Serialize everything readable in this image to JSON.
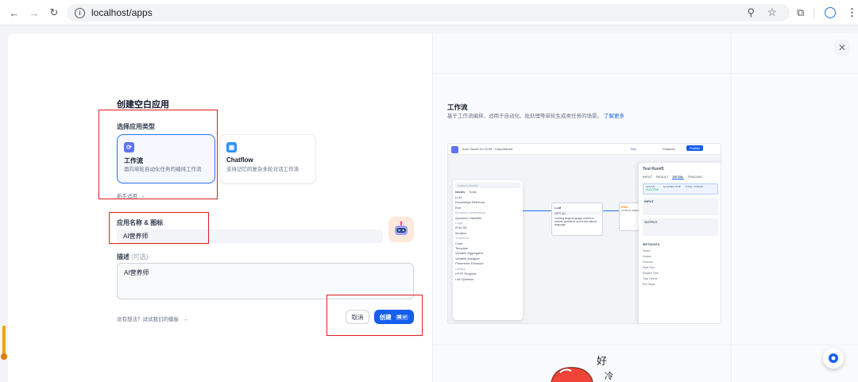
{
  "browser": {
    "url": "localhost/apps",
    "icons": [
      "back-icon",
      "forward-icon",
      "reload-icon",
      "info-icon",
      "zoom-icon",
      "star-icon",
      "extensions-icon",
      "profile-icon",
      "menu-icon"
    ]
  },
  "dialog": {
    "title": "创建空白应用",
    "app_type": {
      "label": "选择应用类型",
      "cards": [
        {
          "title": "工作流",
          "desc": "面向单轮自动化任务的编排工作流",
          "icon_color": "#6172f3",
          "selected": true
        },
        {
          "title": "Chatflow",
          "desc": "支持记忆的复杂多轮对话工作流",
          "icon_color": "#2e90fa",
          "selected": false
        }
      ],
      "newbie_link": "新手适用"
    },
    "name_icon": {
      "label": "应用名称 & 图标",
      "value": "AI营养师"
    },
    "description": {
      "label": "描述",
      "optional": "(可选)",
      "value": "AI营养师"
    },
    "template_hint": "没有想法？试试我们的模板",
    "cancel_label": "取消",
    "create_label": "创建",
    "create_shortcut": "⌘ ↵"
  },
  "preview": {
    "title": "工作流",
    "desc": "基于工作流编排，适用于自动化、批处理等单轮生成类任务的场景。",
    "learn_more": "了解更多",
    "screenshot": {
      "app_name": "Auto Saved 01:02:35 · Unpublished",
      "run": "Run",
      "features": "Features",
      "publish": "Publish",
      "search_placeholder": "Search blocks",
      "tabs": [
        "Nodes",
        "Tools"
      ],
      "nodes_group1": [
        "LLM",
        "Knowledge Retrieval",
        "End"
      ],
      "group_qu": "Question Understand",
      "nodes_group2": [
        "Question Classifier"
      ],
      "group_logic": "Logic",
      "nodes_group3": [
        "IF/ELSE",
        "Iteration"
      ],
      "group_transform": "Transform",
      "nodes_group4": [
        "Code",
        "Template",
        "Variable Aggregator",
        "Variable Assigner",
        "Parameter Extractor"
      ],
      "group_utilities": "Utilities",
      "nodes_group5": [
        "HTTP Request",
        "List Operator"
      ],
      "llm_node": "LLM",
      "llm_model": "GPT-4o",
      "llm_text": "Invoking large language models to answer questions or process natural language",
      "end_node": "END",
      "output_var": "OUTPUT VARIABLE",
      "test_title": "Test Run#5",
      "test_tabs": [
        "INPUT",
        "RESULT",
        "DETAIL",
        "TRACING"
      ],
      "test_status": "STATUS",
      "test_success": "SUCCESS",
      "test_elapsed": "ELAPSED TIME",
      "test_tokens": "TOTAL TOKENS",
      "input_label": "INPUT",
      "output_label": "OUTPUT",
      "metadata_label": "METADATA",
      "meta_keys": [
        "Status",
        "Version",
        "Executor",
        "Start Time",
        "Elapsed Time",
        "Total Tokens",
        "Run Steps"
      ]
    }
  },
  "colors": {
    "primary": "#155eef",
    "annotation": "#e31b23"
  }
}
